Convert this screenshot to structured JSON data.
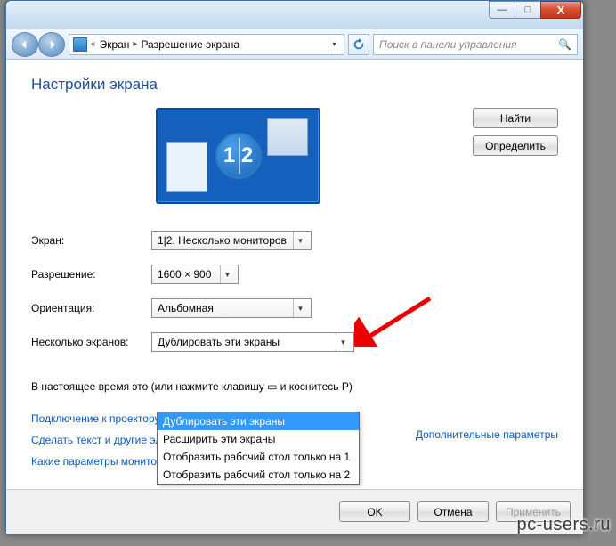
{
  "window_controls": {
    "min": "—",
    "max": "□",
    "close": "X"
  },
  "breadcrumb": {
    "item1": "Экран",
    "item2": "Разрешение экрана"
  },
  "search": {
    "placeholder": "Поиск в панели управления"
  },
  "page_title": "Настройки экрана",
  "side_buttons": {
    "find": "Найти",
    "identify": "Определить"
  },
  "monitor_badge": "1 2",
  "labels": {
    "screen": "Экран:",
    "resolution": "Разрешение:",
    "orientation": "Ориентация:",
    "multi": "Несколько экранов:"
  },
  "values": {
    "screen": "1|2. Несколько мониторов",
    "resolution": "1600 × 900",
    "orientation": "Альбомная",
    "multi": "Дублировать эти экраны"
  },
  "dropdown_options": [
    "Дублировать эти экраны",
    "Расширить эти экраны",
    "Отобразить рабочий стол только на 1",
    "Отобразить рабочий стол только на 2"
  ],
  "status_prefix": "В настоящее время это ",
  "status_suffix": " (или нажмите клавишу ▭ и коснитесь P)",
  "adv_link": "Дополнительные параметры",
  "projector_link": "Подключение к проектору",
  "text_link": "Сделать текст и другие элементы больше или меньше",
  "which_link": "Какие параметры монитора следует выбрать?",
  "footer": {
    "ok": "OK",
    "cancel": "Отмена",
    "apply": "Применить"
  },
  "watermark": "pc-users.ru"
}
